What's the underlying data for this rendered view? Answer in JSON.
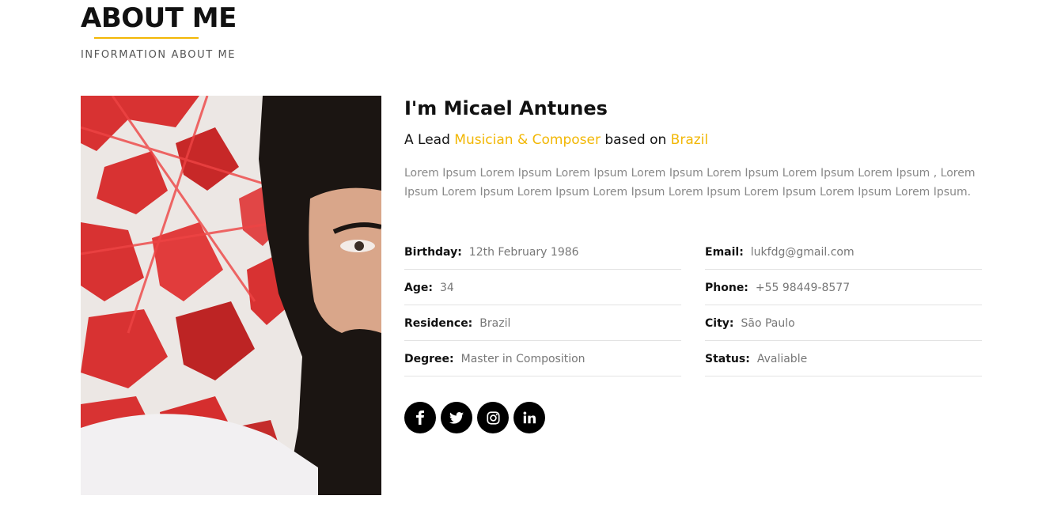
{
  "section": {
    "title": "ABOUT ME",
    "subtitle": "INFORMATION ABOUT ME"
  },
  "profile": {
    "name": "I'm Micael Antunes",
    "tagline": {
      "prefix": "A Lead ",
      "role": "Musician & Composer",
      "middle": " based on ",
      "location": "Brazil"
    },
    "bio": "Lorem Ipsum Lorem Ipsum Lorem Ipsum Lorem Ipsum Lorem Ipsum Lorem Ipsum Lorem Ipsum , Lorem Ipsum Lorem Ipsum Lorem Ipsum Lorem Ipsum Lorem Ipsum Lorem Ipsum Lorem Ipsum Lorem Ipsum.",
    "details_left": [
      {
        "label": "Birthday:",
        "value": "12th February 1986"
      },
      {
        "label": "Age:",
        "value": "34"
      },
      {
        "label": "Residence:",
        "value": "Brazil"
      },
      {
        "label": "Degree:",
        "value": "Master in Composition"
      }
    ],
    "details_right": [
      {
        "label": "Email:",
        "value": "lukfdg@gmail.com"
      },
      {
        "label": "Phone:",
        "value": "+55 98449-8577"
      },
      {
        "label": "City:",
        "value": "São Paulo"
      },
      {
        "label": "Status:",
        "value": "Avaliable"
      }
    ]
  },
  "social": [
    {
      "icon": "facebook-icon"
    },
    {
      "icon": "twitter-icon"
    },
    {
      "icon": "instagram-icon"
    },
    {
      "icon": "linkedin-icon"
    }
  ],
  "colors": {
    "accent": "#f2b705",
    "text": "#111111",
    "muted": "#777777"
  }
}
